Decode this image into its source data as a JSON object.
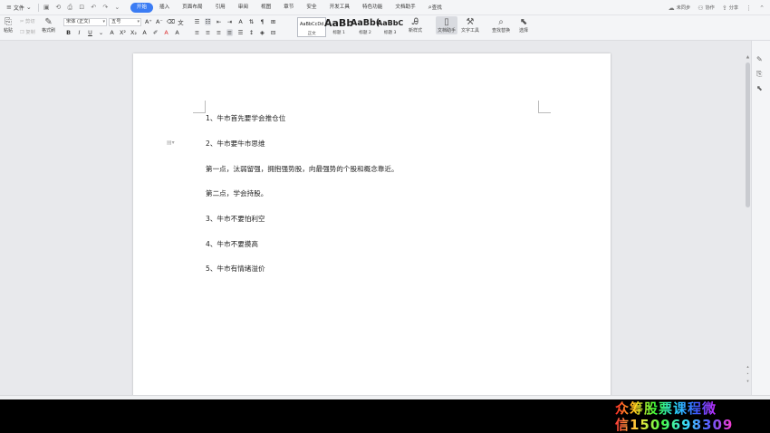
{
  "menubar": {
    "file_label": "文件",
    "tabs": [
      {
        "label": "开始",
        "active": true
      },
      {
        "label": "插入"
      },
      {
        "label": "页面布局"
      },
      {
        "label": "引用"
      },
      {
        "label": "审阅"
      },
      {
        "label": "视图"
      },
      {
        "label": "章节"
      },
      {
        "label": "安全"
      },
      {
        "label": "开发工具"
      },
      {
        "label": "特色功能"
      },
      {
        "label": "文档助手"
      },
      {
        "label": "查找"
      }
    ],
    "right": {
      "sync_label": "未同步",
      "collab_label": "协作",
      "share_label": "分享"
    }
  },
  "ribbon": {
    "paste_label": "粘贴",
    "cut_label": "剪切",
    "copy_label": "复制",
    "format_painter_label": "格式刷",
    "font_name": "宋体 (正文)",
    "font_size": "五号",
    "styles": [
      {
        "sample": "AaBbCcDd",
        "label": "正文"
      },
      {
        "sample": "AaBb",
        "label": "标题 1"
      },
      {
        "sample": "AaBb(",
        "label": "标题 2"
      },
      {
        "sample": "AaBbC",
        "label": "标题 3"
      }
    ],
    "new_style_label": "新样式",
    "doc_assistant_label": "文档助手",
    "text_tools_label": "文字工具",
    "find_replace_label": "查找替换",
    "select_label": "选择"
  },
  "document": {
    "lines": [
      "1、牛市首先要学会推仓位",
      "2、牛市要牛市思维",
      "第一点，汰弱留强，拥抱强势股，向最强势的个股和概念靠近。",
      "第二点，学会持股。",
      "3、牛市不要怕利空",
      "4、牛市不要摸高",
      "5、牛市有情绪溢价"
    ]
  },
  "watermark": {
    "line1": "众筹股票课程微",
    "line2": "信1509698309"
  },
  "colors": {
    "accent": "#3b7cf4",
    "ribbon_bg": "#f4f5f7",
    "workspace_bg": "#e8e9ec"
  }
}
